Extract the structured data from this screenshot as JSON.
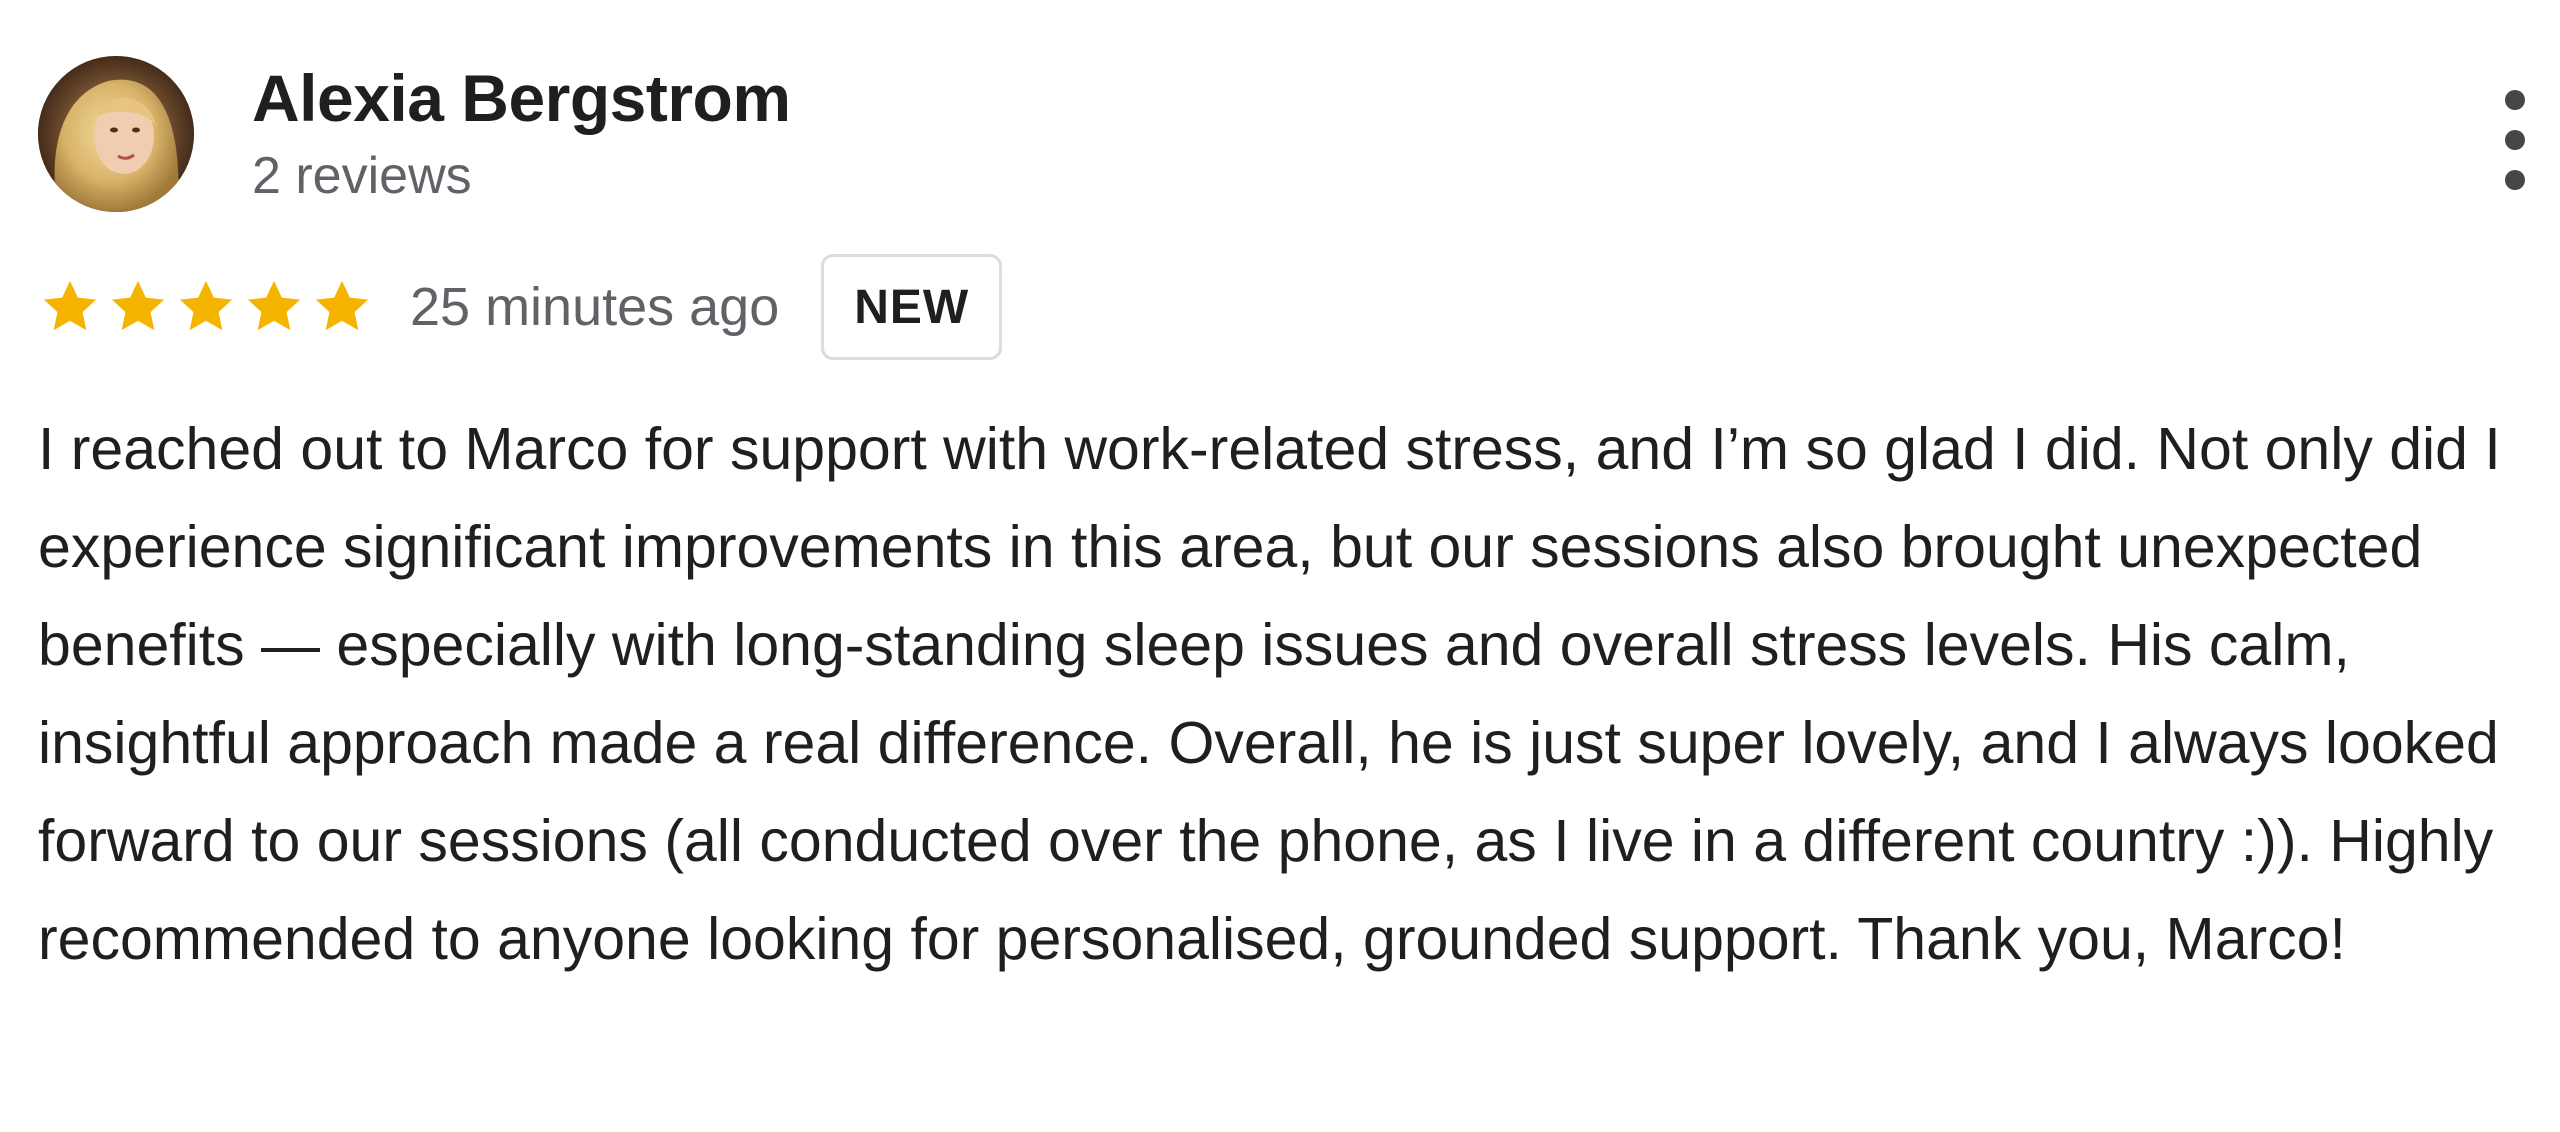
{
  "review": {
    "author": {
      "name": "Alexia Bergstrom",
      "reviews_count": "2 reviews",
      "avatar": "profile-photo"
    },
    "rating": {
      "stars": 5,
      "max_stars": 5,
      "star_color": "#F4B400"
    },
    "timestamp": "25 minutes ago",
    "badge": "NEW",
    "text": "I reached out to Marco for support with work-related stress, and I’m so glad I did. Not only did I experience significant improvements in this area, but our sessions also brought unexpected benefits — especially with long-standing sleep issues and overall stress levels. His calm, insightful approach made a real difference. Overall, he is just super lovely, and I always looked forward to our sessions (all conducted over the phone, as I live in a different country :)). Highly recommended to anyone looking for personalised, grounded support. Thank you, Marco!",
    "menu_icon": "more-vertical-icon"
  },
  "colors": {
    "text_primary": "#1F1F1F",
    "text_secondary": "#5F6368",
    "badge_border": "#DADCE0"
  }
}
